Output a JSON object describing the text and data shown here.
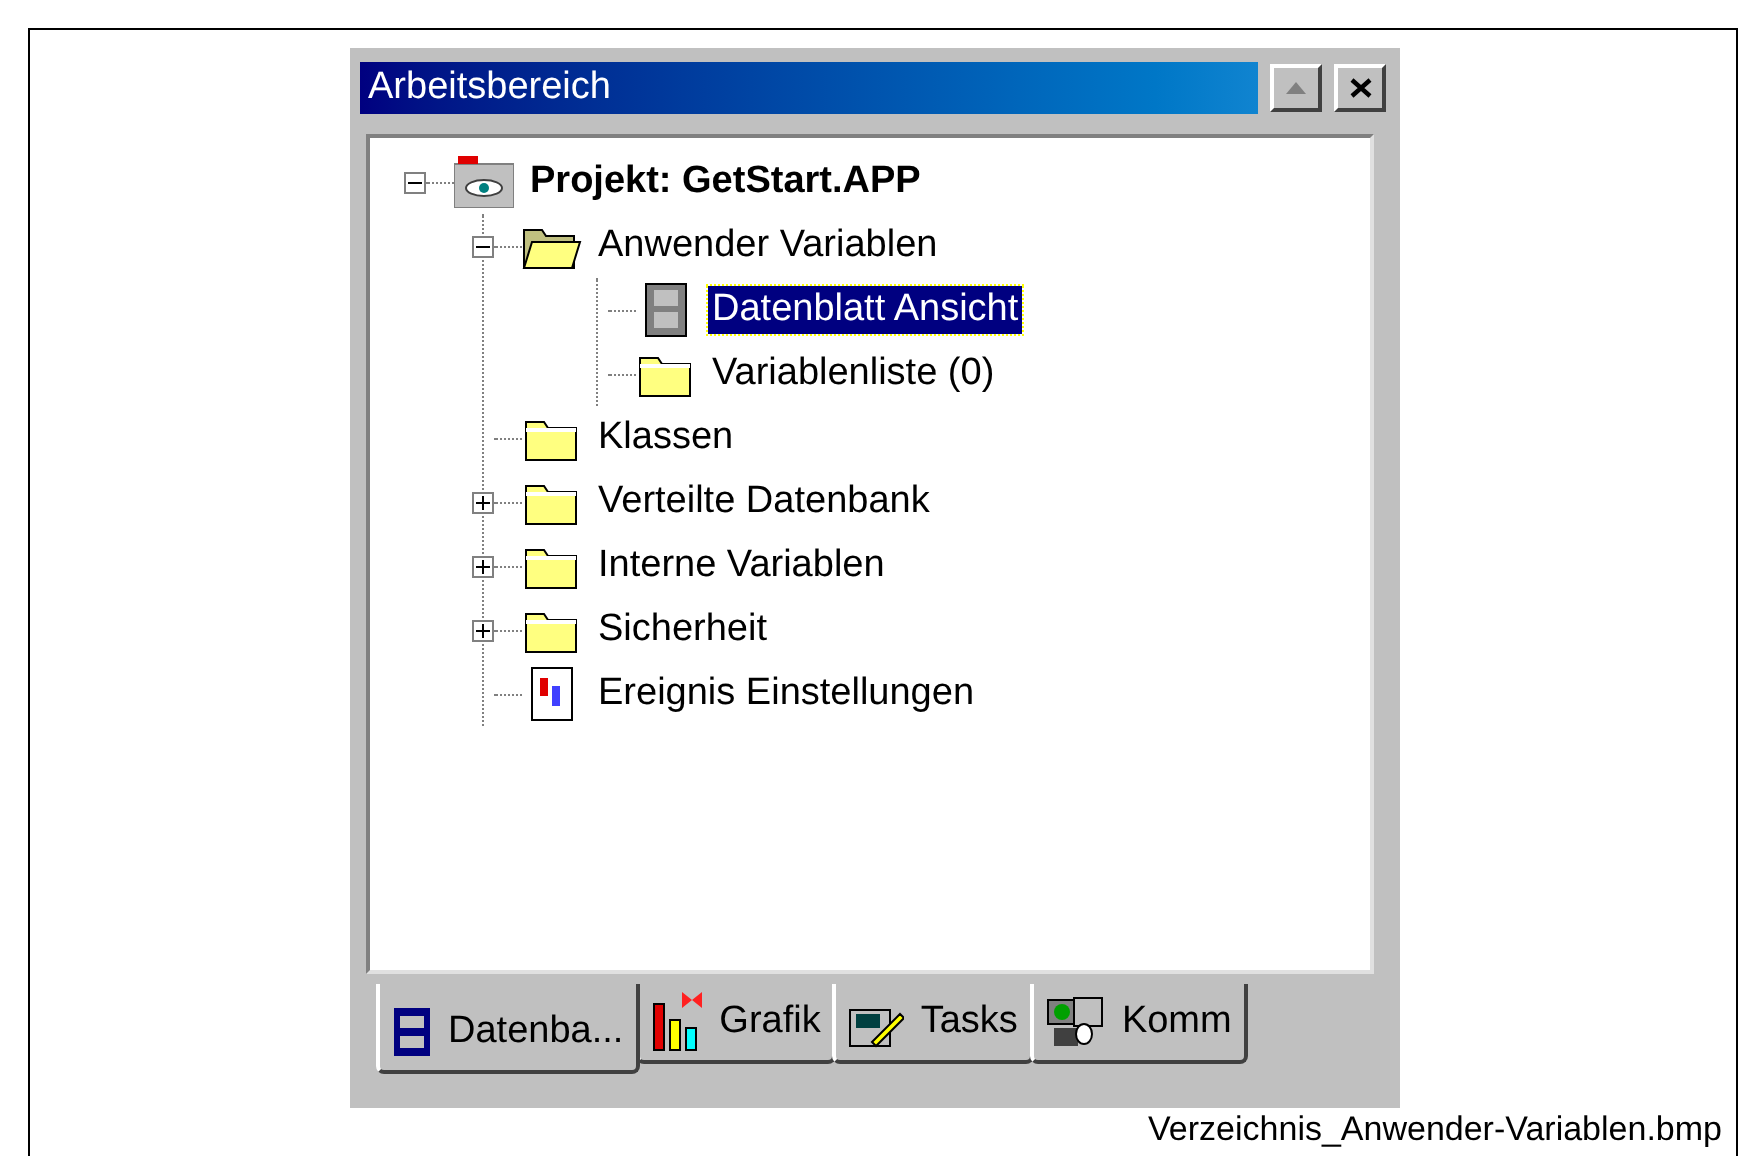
{
  "window": {
    "title": "Arbeitsbereich"
  },
  "tree": [
    {
      "label": "Projekt: GetStart.APP",
      "kind": "project",
      "expanded": true,
      "selected": false,
      "children": [
        {
          "label": "Anwender Variablen",
          "kind": "folder-open",
          "expanded": true,
          "selected": false,
          "children": [
            {
              "label": "Datenblatt Ansicht",
              "kind": "datasheet",
              "selected": true
            },
            {
              "label": "Variablenliste (0)",
              "kind": "folder",
              "selected": false
            }
          ]
        },
        {
          "label": "Klassen",
          "kind": "folder",
          "selected": false
        },
        {
          "label": "Verteilte Datenbank",
          "kind": "folder",
          "expanded": false,
          "selected": false
        },
        {
          "label": "Interne Variablen",
          "kind": "folder",
          "expanded": false,
          "selected": false
        },
        {
          "label": "Sicherheit",
          "kind": "folder",
          "expanded": false,
          "selected": false
        },
        {
          "label": "Ereignis Einstellungen",
          "kind": "events",
          "selected": false
        }
      ]
    }
  ],
  "tabs": [
    {
      "label": "Datenba...",
      "kind": "cabinet",
      "selected": true
    },
    {
      "label": "Grafik",
      "kind": "chart",
      "selected": false
    },
    {
      "label": "Tasks",
      "kind": "tasks",
      "selected": false
    },
    {
      "label": "Komm",
      "kind": "network",
      "selected": false
    }
  ],
  "caption": "Verzeichnis_Anwender-Variablen.bmp"
}
